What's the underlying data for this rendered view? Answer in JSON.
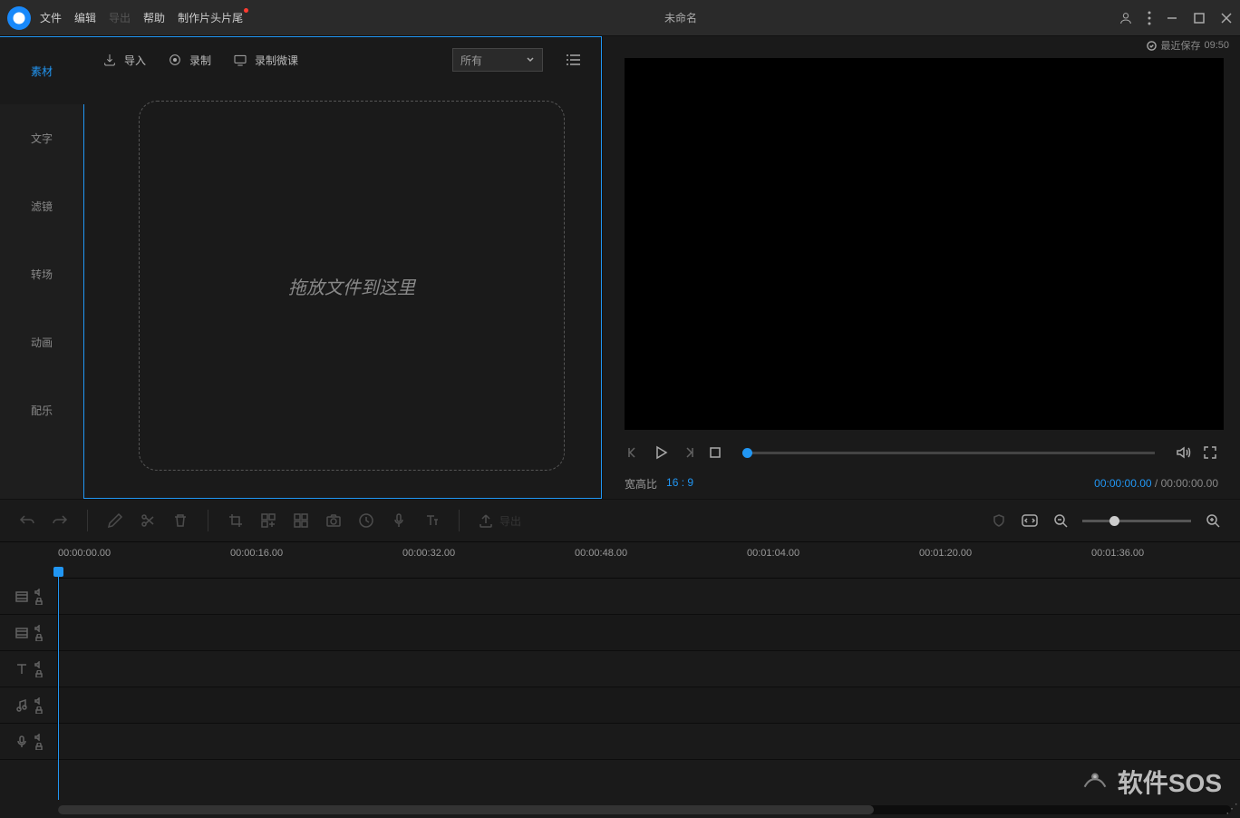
{
  "titlebar": {
    "menu": {
      "file": "文件",
      "edit": "编辑",
      "export": "导出",
      "help": "帮助",
      "credits": "制作片头片尾"
    },
    "title": "未命名"
  },
  "saveInfo": {
    "label": "最近保存",
    "time": "09:50"
  },
  "sidebar": {
    "tabs": [
      "素材",
      "文字",
      "滤镜",
      "转场",
      "动画",
      "配乐"
    ]
  },
  "mediaToolbar": {
    "import": "导入",
    "record": "录制",
    "recordMicro": "录制微课",
    "filter": "所有"
  },
  "dropzone": {
    "text": "拖放文件到这里"
  },
  "preview": {
    "aspectLabel": "宽高比",
    "aspectValue": "16 : 9",
    "currentTime": "00:00:00.00",
    "totalTime": "00:00:00.00"
  },
  "timelineToolbar": {
    "export": "导出"
  },
  "ruler": {
    "marks": [
      "00:00:00.00",
      "00:00:16.00",
      "00:00:32.00",
      "00:00:48.00",
      "00:01:04.00",
      "00:01:20.00",
      "00:01:36.00"
    ]
  },
  "watermark": "软件SOS"
}
